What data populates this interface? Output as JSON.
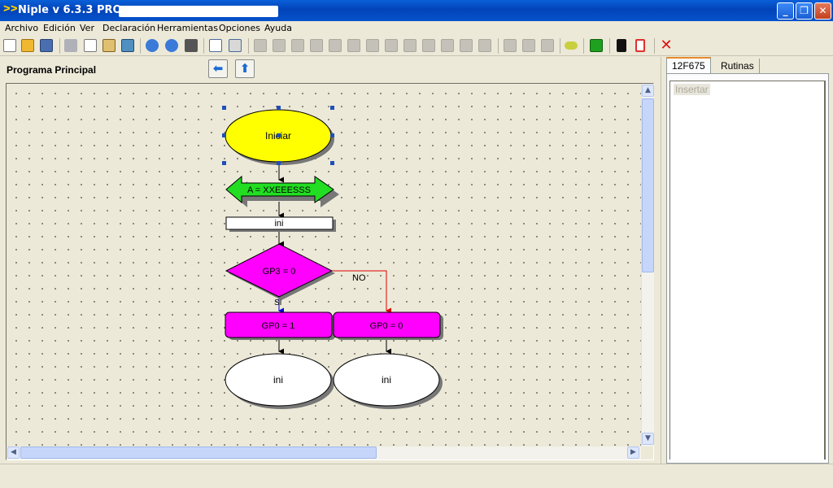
{
  "window": {
    "title": "Niple v 6.3.3 PRO -",
    "app_icon": "ᐳᐳ",
    "minimize": "_",
    "maximize": "❐",
    "close": "✕"
  },
  "menu": [
    "Archivo",
    "Edición",
    "Ver",
    "Declaración",
    "Herramientas",
    "Opciones",
    "Ayuda"
  ],
  "panel": {
    "title": "Programa Principal",
    "back": "⬅",
    "up": "⬆"
  },
  "flowchart": {
    "start": "Iniciar",
    "io_block": "A = XXEEESSS",
    "process_block": "ini",
    "decision": "GP3 = 0",
    "branch_no": "NO",
    "branch_yes": "SI",
    "yes_action": "GP0 = 1",
    "no_action": "GP0 = 0",
    "end_yes": "ini",
    "end_no": "ini",
    "colors": {
      "start": "#ffff00",
      "io_block": "#22dd22",
      "decision": "#ff00ff",
      "action": "#ff00ff",
      "no_line": "#e00000",
      "yes_line": "#0000dd",
      "selection": "#1f4fb8"
    }
  },
  "sidebar": {
    "tabs": [
      "12F675",
      "Rutinas"
    ],
    "insert_label": "Insertar"
  },
  "scroll": {
    "up": "▲",
    "down": "▼",
    "left": "◀",
    "right": "▶"
  }
}
